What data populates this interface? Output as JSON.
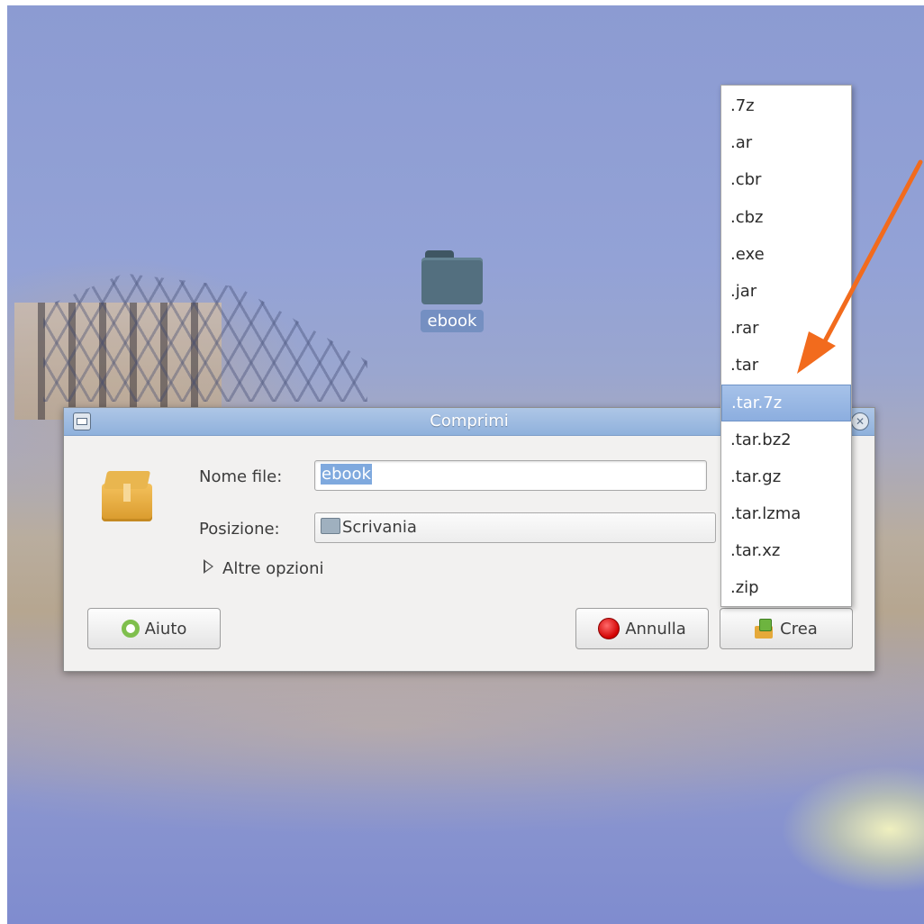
{
  "desktop": {
    "folder_label": "ebook"
  },
  "dialog": {
    "title": "Comprimi",
    "filename_label": "Nome file:",
    "filename_value": "ebook",
    "location_label": "Posizione:",
    "location_value": "Scrivania",
    "more_options": "Altre opzioni",
    "help_button": "Aiuto",
    "cancel_button": "Annulla",
    "create_button": "Crea"
  },
  "extension_menu": {
    "items": [
      ".7z",
      ".ar",
      ".cbr",
      ".cbz",
      ".exe",
      ".jar",
      ".rar",
      ".tar",
      ".tar.7z",
      ".tar.bz2",
      ".tar.gz",
      ".tar.lzma",
      ".tar.xz",
      ".zip"
    ],
    "selected": ".tar.7z"
  },
  "annotation": {
    "arrow_color": "#f26b1d"
  }
}
